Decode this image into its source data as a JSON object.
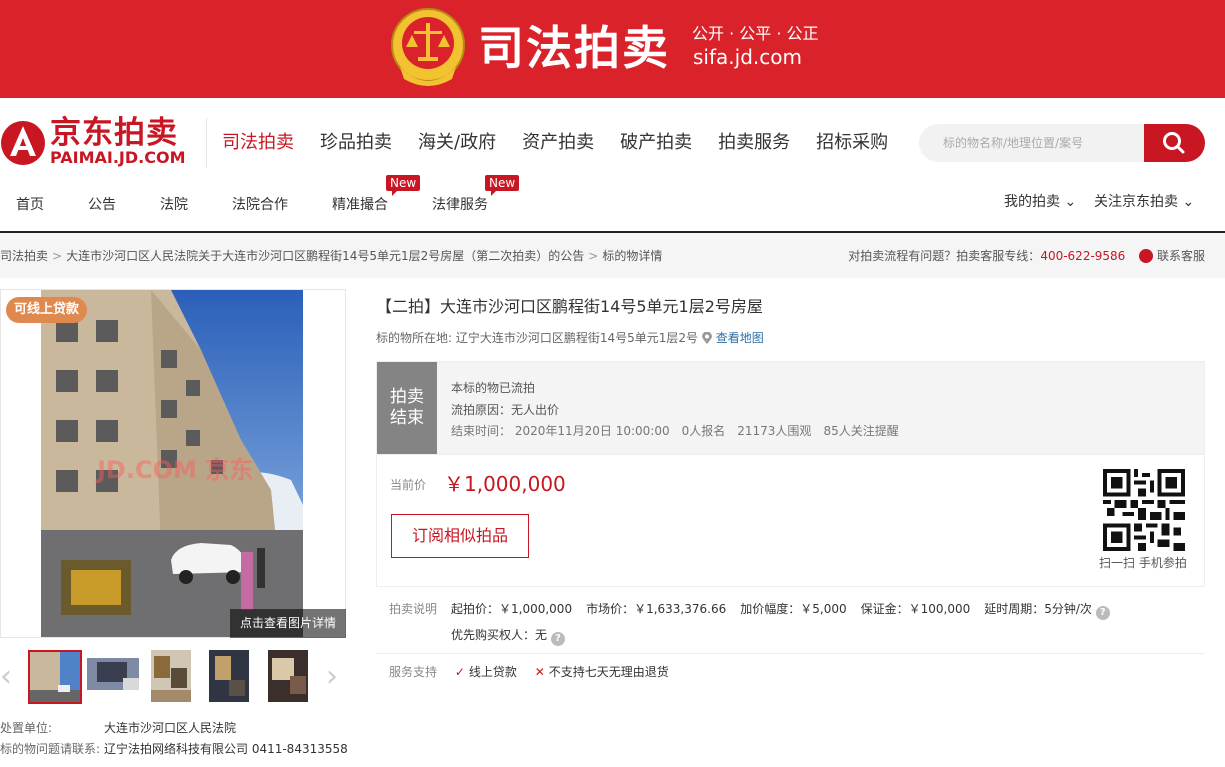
{
  "banner": {
    "title": "司法拍卖",
    "slogan": "公开 · 公平 · 公正",
    "url": "sifa.jd.com"
  },
  "header": {
    "logo_cn": "京东拍卖",
    "logo_en": "PAIMAI.JD.COM",
    "main_nav": [
      "司法拍卖",
      "珍品拍卖",
      "海关/政府",
      "资产拍卖",
      "破产拍卖",
      "拍卖服务",
      "招标采购"
    ],
    "search_placeholder": "标的物名称/地理位置/案号",
    "sub_nav": [
      "首页",
      "公告",
      "法院",
      "法院合作",
      "精准撮合",
      "法律服务"
    ],
    "new_badge": "New",
    "my_auction": "我的拍卖",
    "follow": "关注京东拍卖"
  },
  "breadcrumb": {
    "items": [
      "司法拍卖",
      "大连市沙河口区人民法院关于大连市沙河口区鹏程街14号5单元1层2号房屋（第二次拍卖）的公告",
      "标的物详情"
    ],
    "help_text": "对拍卖流程有问题？拍卖客服专线：",
    "hotline": "400-622-9586",
    "contact": "联系客服"
  },
  "gallery": {
    "loan_tag": "可线上贷款",
    "watermark": "JD.COM 京东",
    "photo_link": "点击查看图片详情"
  },
  "seller": {
    "unit_label": "处置单位:",
    "unit": "大连市沙河口区人民法院",
    "contact_label": "标的物问题请联系:",
    "contact": "辽宁法拍网络科技有限公司 0411-84313558"
  },
  "lot": {
    "title": "【二拍】大连市沙河口区鹏程街14号5单元1层2号房屋",
    "location_label": "标的物所在地:",
    "location": "辽宁大连市沙河口区鹏程街14号5单元1层2号",
    "map_link": "查看地图"
  },
  "status": {
    "tag_line1": "拍卖",
    "tag_line2": "结束",
    "headline": "本标的物已流拍",
    "reason": "流拍原因：无人出价",
    "end_time": "结束时间：  2020年11月20日 10:00:00",
    "signups": "0人报名",
    "views": "21173人围观",
    "followers": "85人关注提醒"
  },
  "price": {
    "label": "当前价",
    "value": "￥1,000,000",
    "subscribe": "订阅相似拍品",
    "qr_caption": "扫一扫 手机参拍"
  },
  "rules": {
    "label": "拍卖说明",
    "start": "起拍价：￥1,000,000",
    "market": "市场价：￥1,633,376.66",
    "increment": "加价幅度：￥5,000",
    "deposit": "保证金：￥100,000",
    "delay": "延时周期：5分钟/次",
    "priority": "优先购买权人：无"
  },
  "services": {
    "label": "服务支持",
    "yes": "线上贷款",
    "no": "不支持七天无理由退货"
  },
  "colors": {
    "brand": "#c81623",
    "banner": "#d9222a",
    "status_tag": "#848484",
    "loan_tag": "#e0894f"
  }
}
